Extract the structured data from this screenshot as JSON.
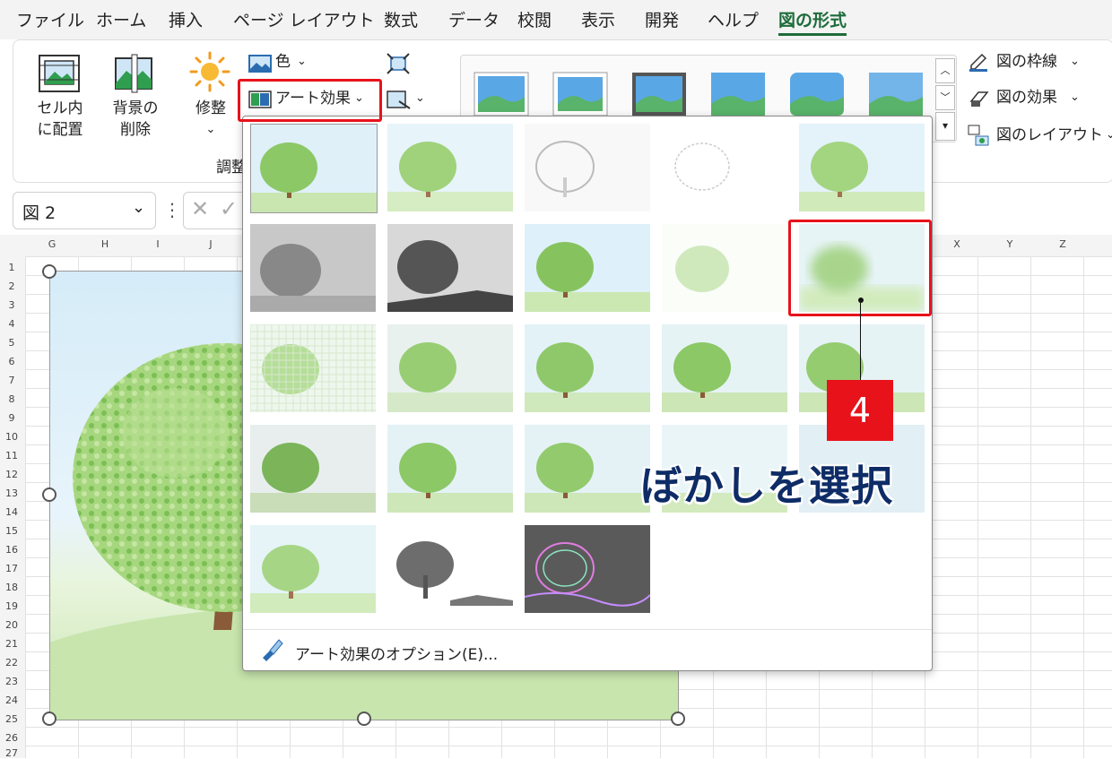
{
  "menu": {
    "items": [
      "ファイル",
      "ホーム",
      "挿入",
      "ページ レイアウト",
      "数式",
      "データ",
      "校閲",
      "表示",
      "開発",
      "ヘルプ"
    ],
    "active": "図の形式"
  },
  "ribbon": {
    "place_in_cell": [
      "セル内",
      "に配置"
    ],
    "remove_background": [
      "背景の",
      "削除"
    ],
    "corrections": "修整",
    "color": "色",
    "art_effects": "アート効果",
    "group_label": "調整",
    "picture_border": "図の枠線",
    "picture_effects": "図の効果",
    "picture_layout": "図のレイアウト"
  },
  "formula_bar": {
    "name_box": "図 2"
  },
  "columns": [
    "G",
    "H",
    "I",
    "J",
    "X",
    "Y",
    "Z"
  ],
  "rows": [
    "1",
    "2",
    "3",
    "4",
    "5",
    "6",
    "7",
    "8",
    "9",
    "10",
    "11",
    "12",
    "13",
    "14",
    "15",
    "16",
    "17",
    "18",
    "19",
    "20",
    "21",
    "22",
    "23",
    "24",
    "25",
    "26",
    "27"
  ],
  "dropdown": {
    "options_label": "アート効果のオプション(E)..."
  },
  "callout": {
    "step": "4",
    "caption": "ぼかしを選択"
  },
  "colors": {
    "accent_green": "#1d6b3a",
    "highlight_red": "#e8121b",
    "caption_navy": "#0e2c66"
  }
}
